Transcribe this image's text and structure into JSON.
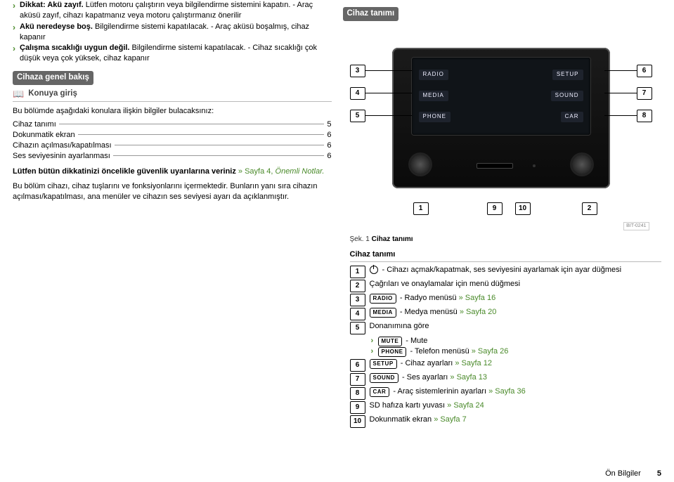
{
  "left": {
    "bullets": [
      {
        "lead": "Dikkat: Akü zayıf.",
        "rest": " Lütfen motoru çalıştırın veya bilgilendirme sistemini kapatın. - Araç aküsü zayıf, cihazı kapatmanız veya motoru çalıştırmanız önerilir"
      },
      {
        "lead": "Akü neredeyse boş.",
        "rest": " Bilgilendirme sistemi kapatılacak. - Araç aküsü boşalmış, cihaz kapanır"
      },
      {
        "lead": "Çalışma sıcaklığı uygun değil.",
        "rest": " Bilgilendirme sistemi kapatılacak. - Cihaz sıcaklığı çok düşük veya çok yüksek, cihaz kapanır"
      }
    ],
    "section_title": "Cihaza genel bakış",
    "subsection": "Konuya giriş",
    "intro": "Bu bölümde aşağıdaki konulara ilişkin bilgiler bulacaksınız:",
    "toc": [
      {
        "label": "Cihaz tanımı",
        "page": "5"
      },
      {
        "label": "Dokunmatik ekran",
        "page": "6"
      },
      {
        "label": "Cihazın açılması/kapatılması",
        "page": "6"
      },
      {
        "label": "Ses seviyesinin ayarlanması",
        "page": "6"
      }
    ],
    "warn_line": "Lütfen bütün dikkatinizi öncelikle güvenlik uyarılarına veriniz",
    "warn_ref": " » Sayfa 4, ",
    "warn_tail": "Önemli Notlar.",
    "para2": "Bu bölüm cihazı, cihaz tuşlarını ve fonksiyonlarını içermektedir. Bunların yanı sıra cihazın açılması/kapatılması, ana menüler ve cihazın ses seviyesi ayarı da açıklanmıştır."
  },
  "right": {
    "heading": "Cihaz tanımı",
    "soft_left": [
      "RADIO",
      "MEDIA",
      "PHONE"
    ],
    "soft_right": [
      "SETUP",
      "SOUND",
      "CAR"
    ],
    "callouts": {
      "1": "1",
      "2": "2",
      "3": "3",
      "4": "4",
      "5": "5",
      "6": "6",
      "7": "7",
      "8": "8",
      "9": "9",
      "10": "10"
    },
    "fig_code": "BIT-0241",
    "fig_caption_prefix": "Şek. 1 ",
    "fig_caption": "Cihaz tanımı",
    "legend_title": "Cihaz tanımı",
    "legend": [
      {
        "n": "1",
        "icon": "power",
        "text": " - Cihazı açmak/kapatmak, ses seviyesini ayarlamak için ayar düğmesi"
      },
      {
        "n": "2",
        "text": "Çağrıları ve onaylamalar için menü düğmesi"
      },
      {
        "n": "3",
        "btn": "RADIO",
        "text": " - Radyo menüsü",
        "ref": " » Sayfa 16"
      },
      {
        "n": "4",
        "btn": "MEDIA",
        "text": " - Medya menüsü",
        "ref": " » Sayfa 20"
      },
      {
        "n": "5",
        "text": "Donanımına göre",
        "sub": [
          {
            "btn": "MUTE",
            "text": " - Mute"
          },
          {
            "btn": "PHONE",
            "text": " - Telefon menüsü",
            "ref": " » Sayfa 26"
          }
        ]
      },
      {
        "n": "6",
        "btn": "SETUP",
        "text": " - Cihaz ayarları",
        "ref": " » Sayfa 12"
      },
      {
        "n": "7",
        "btn": "SOUND",
        "text": " - Ses ayarları",
        "ref": " » Sayfa 13"
      },
      {
        "n": "8",
        "btn": "CAR",
        "text": " - Araç sistemlerinin ayarları",
        "ref": " » Sayfa 36"
      },
      {
        "n": "9",
        "text": "SD hafıza kartı yuvası",
        "ref": " » Sayfa 24"
      },
      {
        "n": "10",
        "text": "Dokunmatik ekran",
        "ref": " » Sayfa 7"
      }
    ]
  },
  "footer": {
    "section": "Ön Bilgiler",
    "page": "5"
  }
}
